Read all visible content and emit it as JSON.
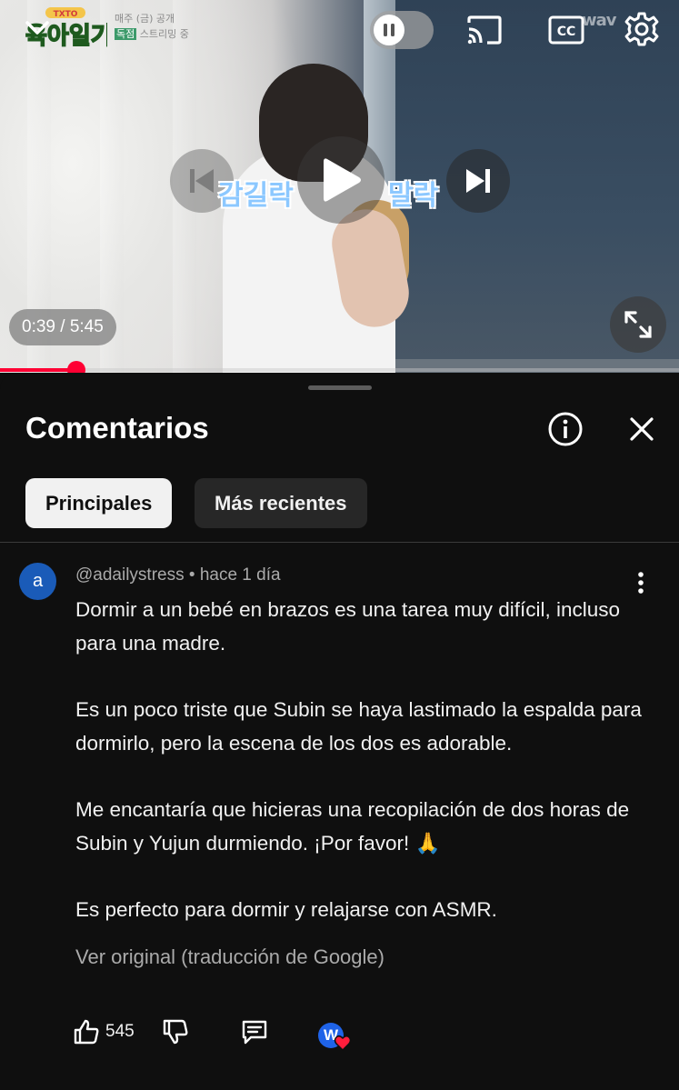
{
  "player": {
    "channel_logo_alt": "육아일기",
    "channel_schedule": "매주 (금) 공개",
    "channel_tag": "독점",
    "channel_streaming": "스트리밍 중",
    "watermark": "wav",
    "subtitle_left": "감길락",
    "subtitle_right": "말락",
    "time_display": "0:39 / 5:45",
    "progress_fraction": 0.113,
    "icons": {
      "collapse": "chevron-down-icon",
      "autoplay": "pause-icon",
      "cast": "cast-icon",
      "captions": "cc-icon",
      "settings": "gear-icon",
      "previous": "skip-previous-icon",
      "play": "play-icon",
      "next": "skip-next-icon",
      "fullscreen": "fullscreen-icon"
    },
    "accent_color": "#ff0033"
  },
  "comments": {
    "title": "Comentarios",
    "chips": [
      "Principales",
      "Más recientes"
    ],
    "active_chip": "Principales",
    "items": [
      {
        "avatar_letter": "a",
        "author": "@adailystress",
        "time": "hace 1 día",
        "paragraphs": [
          "Dormir a un bebé en brazos es una tarea muy difícil, incluso para una madre.",
          "Es un poco triste que Subin se haya lastimado la espalda para dormirlo, pero la escena de los dos es adorable.",
          "Me encantaría que hicieras una recopilación de dos horas de Subin y Yujun durmiendo. ¡Por favor! 🙏",
          "Es perfecto para dormir y relajarse con ASMR."
        ],
        "translation_link": "Ver original (traducción de Google)",
        "likes": "545",
        "creator_avatar_letter": "W"
      }
    ]
  }
}
